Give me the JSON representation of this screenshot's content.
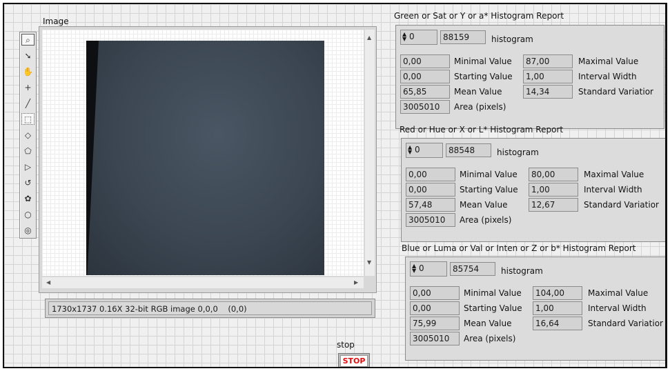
{
  "image_panel": {
    "label": "Image",
    "status": "1730x1737 0.16X 32-bit RGB image 0,0,0    (0,0)"
  },
  "tools": [
    {
      "icon": "zoom-icon",
      "glyph": "⌕"
    },
    {
      "icon": "pointer-icon",
      "glyph": "➘"
    },
    {
      "icon": "pan-hand-icon",
      "glyph": "✋"
    },
    {
      "icon": "point-icon",
      "glyph": "+"
    },
    {
      "icon": "line-icon",
      "glyph": "╱"
    },
    {
      "icon": "rectangle-icon",
      "glyph": "⬚"
    },
    {
      "icon": "rotated-rectangle-icon",
      "glyph": "◇"
    },
    {
      "icon": "polygon-icon",
      "glyph": "⬠"
    },
    {
      "icon": "polyline-icon",
      "glyph": "▷"
    },
    {
      "icon": "freehand-line-icon",
      "glyph": "↺"
    },
    {
      "icon": "freehand-region-icon",
      "glyph": "✿"
    },
    {
      "icon": "oval-icon",
      "glyph": "○"
    },
    {
      "icon": "annulus-icon",
      "glyph": "◎"
    }
  ],
  "stop": {
    "label": "stop",
    "button_text": "STOP"
  },
  "labels": {
    "minimal_value": "Minimal Value",
    "maximal_value": "Maximal Value",
    "starting_value": "Starting Value",
    "interval_width": "Interval Width",
    "mean_value": "Mean Value",
    "standard_variation": "Standard Variatior",
    "area": "Area (pixels)",
    "histogram": "histogram"
  },
  "reports": {
    "green": {
      "title": "Green or Sat or Y or a* Histogram Report",
      "index": "0",
      "histogram_value": "88159",
      "minimal": "0,00",
      "maximal": "87,00",
      "starting": "0,00",
      "interval": "1,00",
      "mean": "65,85",
      "std": "14,34",
      "area": "3005010"
    },
    "red": {
      "title": "Red or Hue or X or L* Histogram Report",
      "index": "0",
      "histogram_value": "88548",
      "minimal": "0,00",
      "maximal": "80,00",
      "starting": "0,00",
      "interval": "1,00",
      "mean": "57,48",
      "std": "12,67",
      "area": "3005010"
    },
    "blue": {
      "title": "Blue or Luma or Val or Inten or Z or b* Histogram Report",
      "index": "0",
      "histogram_value": "85754",
      "minimal": "0,00",
      "maximal": "104,00",
      "starting": "0,00",
      "interval": "1,00",
      "mean": "75,99",
      "std": "16,64",
      "area": "3005010"
    }
  }
}
